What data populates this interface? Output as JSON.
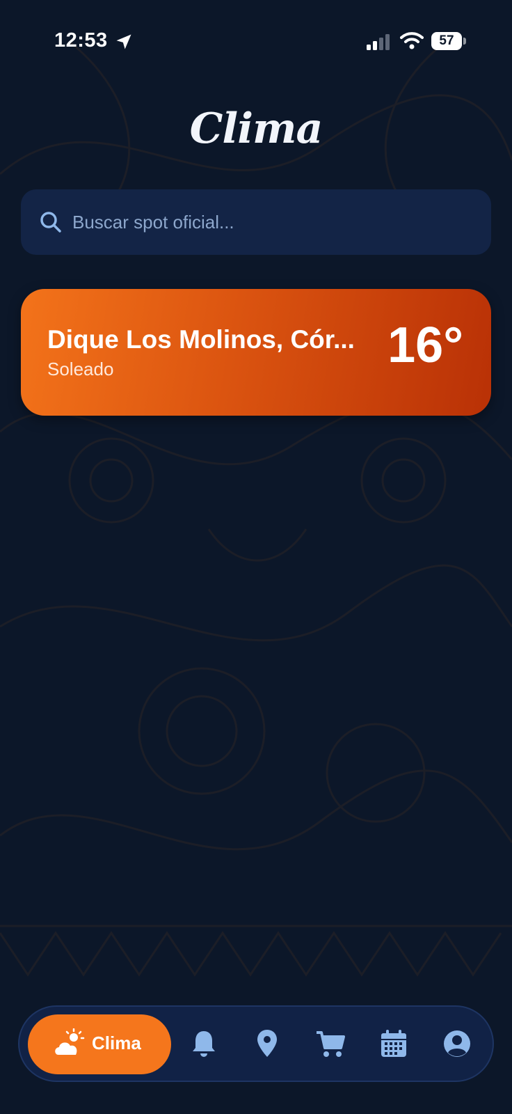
{
  "status_bar": {
    "time": "12:53",
    "battery": "57"
  },
  "app": {
    "logo_text": "Clima"
  },
  "search": {
    "placeholder": "Buscar spot oficial..."
  },
  "weather_card": {
    "location": "Dique Los Molinos, Cór...",
    "condition": "Soleado",
    "temperature": "16°"
  },
  "bottom_nav": {
    "active_label": "Clima",
    "items": [
      {
        "icon": "weather-icon",
        "label": "Clima"
      },
      {
        "icon": "bell-icon"
      },
      {
        "icon": "location-pin-icon"
      },
      {
        "icon": "cart-icon"
      },
      {
        "icon": "calendar-icon"
      },
      {
        "icon": "profile-icon"
      }
    ]
  },
  "colors": {
    "background": "#0c1729",
    "accent": "#f5761c",
    "nav_bg": "#112246",
    "icon_blue": "#8fb8ea"
  }
}
